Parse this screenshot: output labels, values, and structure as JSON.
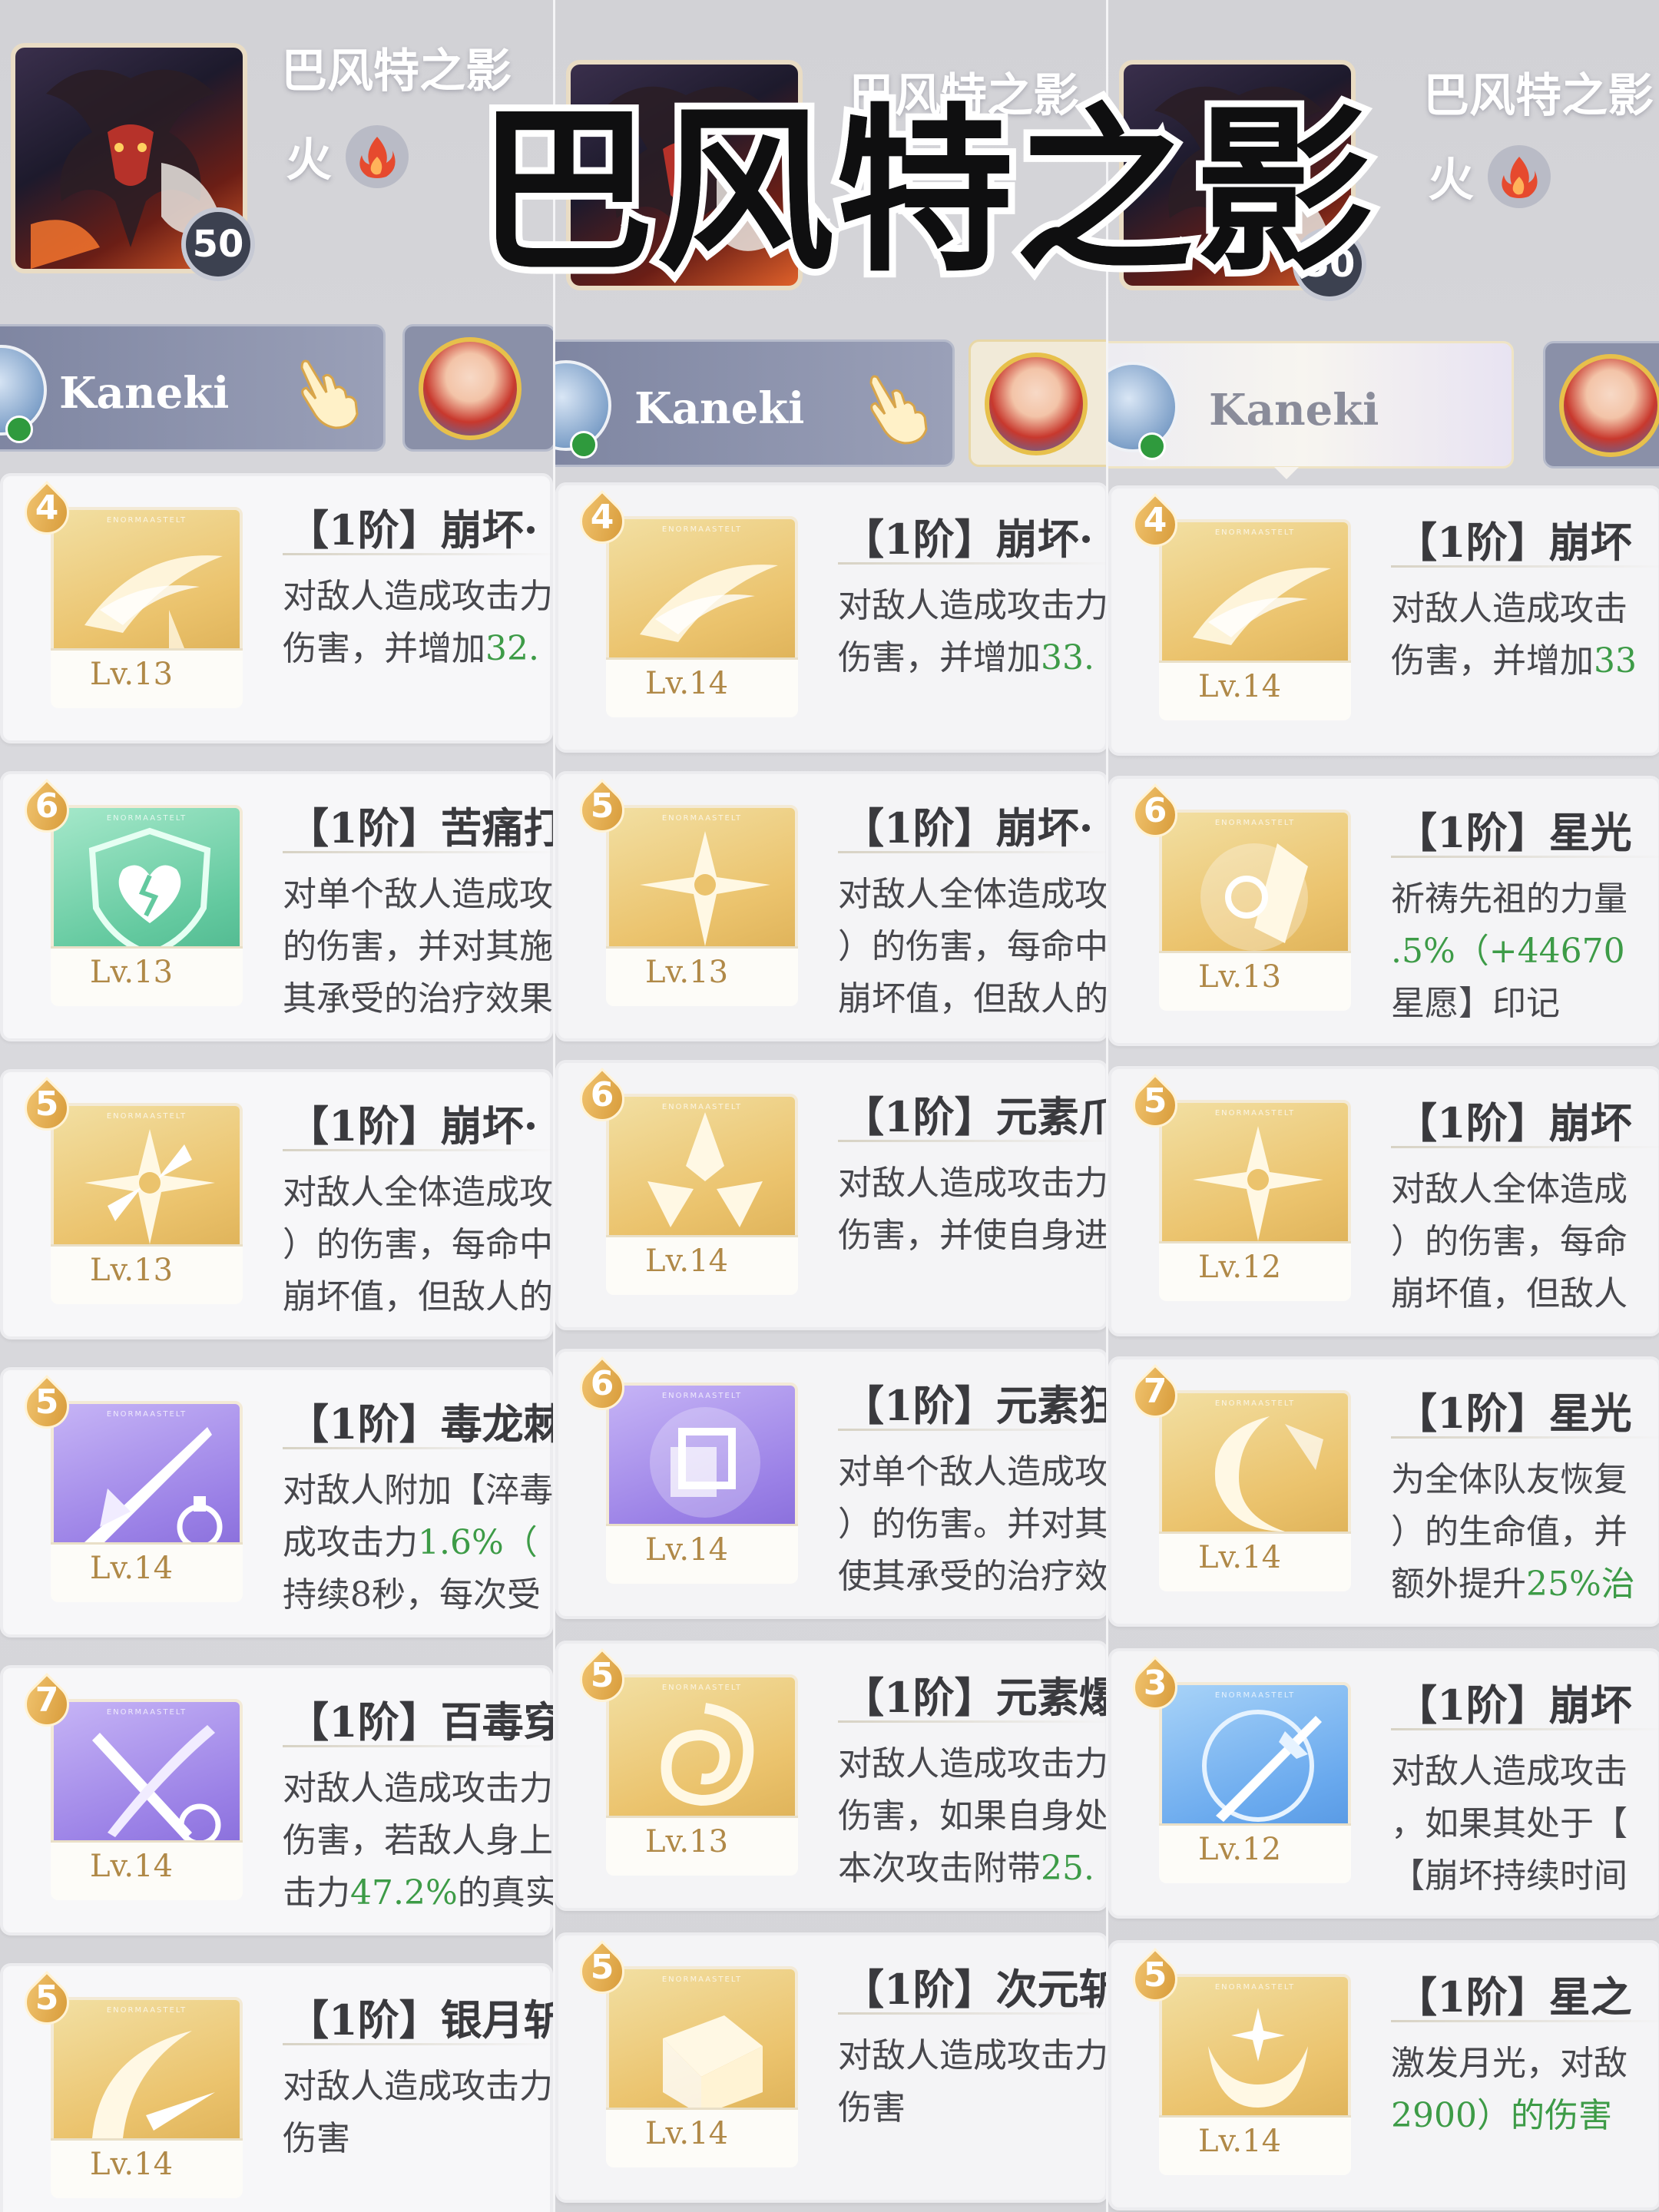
{
  "overlay_title": "巴风特之影",
  "columns": [
    {
      "header": {
        "name": "巴风特之影",
        "element": "火",
        "level": "50"
      },
      "player": {
        "name": "Kaneki"
      },
      "skills": [
        {
          "cost": "4",
          "color": "gold",
          "level": "Lv.13",
          "title": "【1阶】崩坏·",
          "lines": [
            [
              "对敌人造成攻击力",
              ""
            ],
            [
              "伤害，并增加",
              "32."
            ],
            [
              "",
              ""
            ]
          ]
        },
        {
          "cost": "6",
          "color": "green",
          "level": "Lv.13",
          "title": "【1阶】苦痛打",
          "lines": [
            [
              "对单个敌人造成攻",
              ""
            ],
            [
              "的伤害，并对其施",
              ""
            ],
            [
              "其承受的治疗效果",
              ""
            ]
          ]
        },
        {
          "cost": "5",
          "color": "gold",
          "level": "Lv.13",
          "title": "【1阶】崩坏·",
          "lines": [
            [
              "对敌人全体造成攻",
              ""
            ],
            [
              "）的伤害，每命中",
              ""
            ],
            [
              "崩坏值，但敌人的",
              ""
            ]
          ]
        },
        {
          "cost": "5",
          "color": "purple",
          "level": "Lv.14",
          "title": "【1阶】毒龙棘",
          "lines": [
            [
              "对敌人附加【淬毒",
              ""
            ],
            [
              "成攻击力",
              "1.6%（"
            ],
            [
              "持续8秒，每次受",
              ""
            ]
          ]
        },
        {
          "cost": "7",
          "color": "purple",
          "level": "Lv.14",
          "title": "【1阶】百毒穿",
          "lines": [
            [
              "对敌人造成攻击力",
              ""
            ],
            [
              "伤害，若敌人身上",
              ""
            ],
            [
              "击力",
              "47.2%",
              "的真实"
            ]
          ]
        },
        {
          "cost": "5",
          "color": "gold",
          "level": "Lv.14",
          "title": "【1阶】银月斩",
          "lines": [
            [
              "对敌人造成攻击力",
              ""
            ],
            [
              "伤害",
              ""
            ],
            [
              "",
              ""
            ]
          ]
        }
      ]
    },
    {
      "header": {
        "name": "巴风特之影",
        "element": "火",
        "level": "50"
      },
      "player": {
        "name": "Kaneki"
      },
      "skills": [
        {
          "cost": "4",
          "color": "gold",
          "level": "Lv.14",
          "title": "【1阶】崩坏·",
          "lines": [
            [
              "对敌人造成攻击力",
              ""
            ],
            [
              "伤害，并增加",
              "33."
            ],
            [
              "",
              ""
            ]
          ]
        },
        {
          "cost": "5",
          "color": "gold",
          "level": "Lv.13",
          "title": "【1阶】崩坏·",
          "lines": [
            [
              "对敌人全体造成攻",
              ""
            ],
            [
              "）的伤害，每命中",
              ""
            ],
            [
              "崩坏值，但敌人的",
              ""
            ]
          ]
        },
        {
          "cost": "6",
          "color": "gold",
          "level": "Lv.14",
          "title": "【1阶】元素爪",
          "lines": [
            [
              "对敌人造成攻击力",
              ""
            ],
            [
              "伤害，并使自身进",
              ""
            ],
            [
              "",
              ""
            ]
          ]
        },
        {
          "cost": "6",
          "color": "purple",
          "level": "Lv.14",
          "title": "【1阶】元素狂",
          "lines": [
            [
              "对单个敌人造成攻",
              ""
            ],
            [
              "）的伤害。并对其",
              ""
            ],
            [
              "使其承受的治疗效",
              ""
            ]
          ]
        },
        {
          "cost": "5",
          "color": "gold",
          "level": "Lv.13",
          "title": "【1阶】元素爆",
          "lines": [
            [
              "对敌人造成攻击力",
              ""
            ],
            [
              "伤害，如果自身处",
              ""
            ],
            [
              "本次攻击附带",
              "25."
            ]
          ]
        },
        {
          "cost": "5",
          "color": "gold",
          "level": "Lv.14",
          "title": "【1阶】次元斩",
          "lines": [
            [
              "对敌人造成攻击力",
              ""
            ],
            [
              "伤害",
              ""
            ],
            [
              "",
              ""
            ]
          ]
        }
      ]
    },
    {
      "header": {
        "name": "巴风特之影",
        "element": "火",
        "level": "50"
      },
      "player": {
        "name": "Kaneki"
      },
      "skills": [
        {
          "cost": "4",
          "color": "gold",
          "level": "Lv.14",
          "title": "【1阶】崩坏",
          "lines": [
            [
              "对敌人造成攻击",
              ""
            ],
            [
              "伤害，并增加",
              "33"
            ],
            [
              "",
              ""
            ]
          ]
        },
        {
          "cost": "6",
          "color": "gold",
          "level": "Lv.13",
          "title": "【1阶】星光",
          "lines": [
            [
              "祈祷先祖的力量",
              ""
            ],
            [
              "",
              ".5%（+44670"
            ],
            [
              "星愿】印记",
              ""
            ]
          ]
        },
        {
          "cost": "5",
          "color": "gold",
          "level": "Lv.12",
          "title": "【1阶】崩坏",
          "lines": [
            [
              "对敌人全体造成",
              ""
            ],
            [
              "）的伤害，每命",
              ""
            ],
            [
              "崩坏值，但敌人",
              ""
            ]
          ]
        },
        {
          "cost": "7",
          "color": "gold",
          "level": "Lv.14",
          "title": "【1阶】星光",
          "lines": [
            [
              "为全体队友恢复",
              ""
            ],
            [
              "）的生命值，并",
              ""
            ],
            [
              "额外提升",
              "25%治"
            ]
          ]
        },
        {
          "cost": "3",
          "color": "blue",
          "level": "Lv.12",
          "title": "【1阶】崩坏",
          "lines": [
            [
              "对敌人造成攻击",
              ""
            ],
            [
              "，如果其处于【",
              ""
            ],
            [
              "【崩坏持续时间",
              ""
            ]
          ]
        },
        {
          "cost": "5",
          "color": "gold",
          "level": "Lv.14",
          "title": "【1阶】星之",
          "lines": [
            [
              "激发月光，对敌",
              ""
            ],
            [
              "",
              "2900）的伤害"
            ],
            [
              "",
              ""
            ]
          ]
        }
      ]
    }
  ]
}
